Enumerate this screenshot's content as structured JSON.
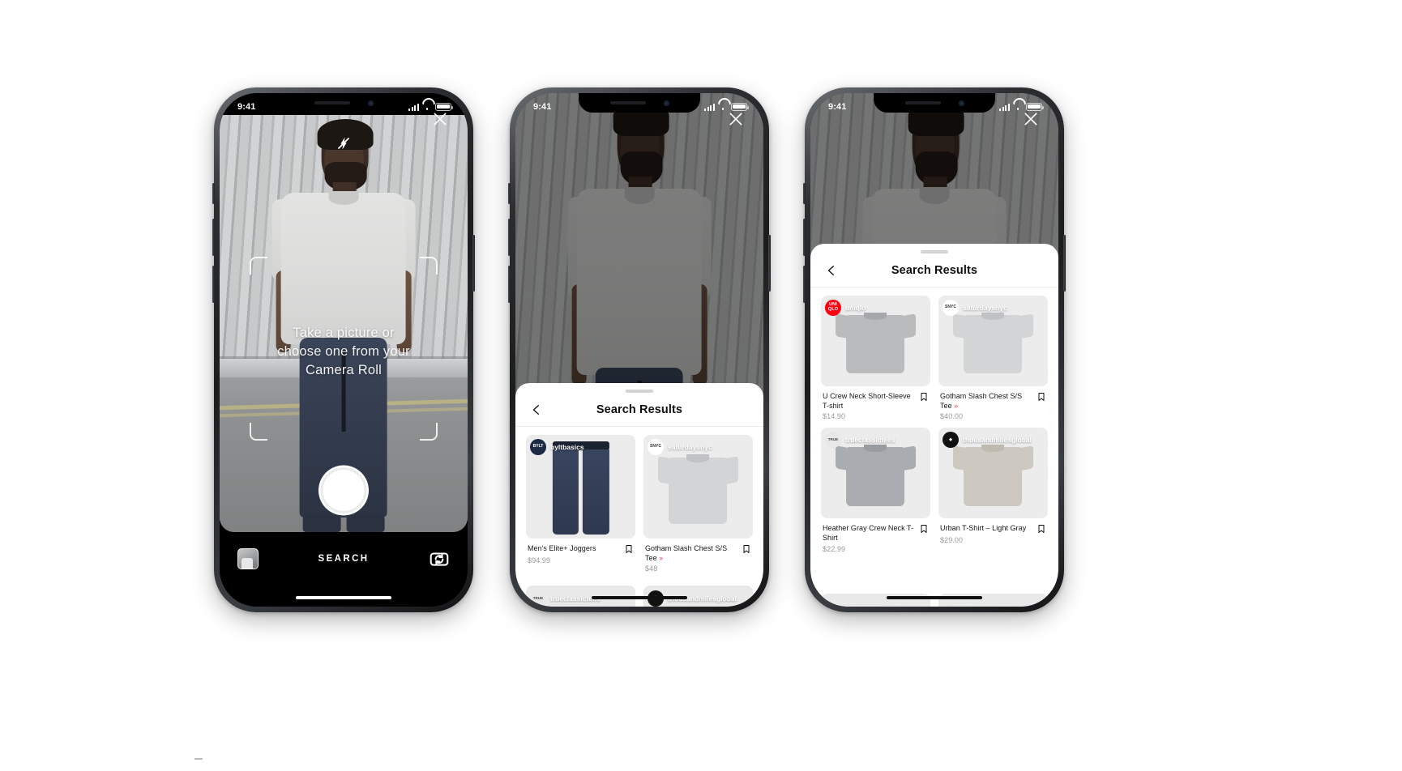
{
  "status_bar": {
    "time": "9:41"
  },
  "camera_screen": {
    "name": "visual-search-camera",
    "hint_lines": [
      "Take a picture or",
      "choose one from your",
      "Camera Roll"
    ],
    "search_label": "SEARCH",
    "icons": {
      "flash": "flash-icon",
      "close": "close-icon",
      "gallery": "gallery-thumbnail-icon",
      "flip": "camera-flip-icon",
      "shutter": "shutter-button"
    }
  },
  "results_sheet": {
    "title": "Search Results",
    "back_icon": "chevron-left-icon",
    "grabber": "sheet-drag-handle"
  },
  "phone2": {
    "products": [
      {
        "brand": "byltbasics",
        "brand_logo_text": "BYLT",
        "title": "Men's Elite+ Joggers",
        "chevron": "",
        "price": "$94.99",
        "type": "joggers",
        "color": "navy"
      },
      {
        "brand": "saturdaysnyc",
        "brand_logo_text": "SNYC",
        "title": "Gotham Slash Chest S/S Tee",
        "chevron": "»",
        "price": "$48",
        "type": "tee",
        "color": "c-lgray"
      },
      {
        "brand": "trueclassictees",
        "brand_logo_text": "TRUE",
        "title": "",
        "chevron": "",
        "price": "",
        "type": "tee",
        "color": "c-mgray"
      },
      {
        "brand": "thousandmilesglobal",
        "brand_logo_text": "◈",
        "title": "",
        "chevron": "",
        "price": "",
        "type": "tee",
        "color": "c-beige"
      }
    ]
  },
  "phone3": {
    "products": [
      {
        "brand": "uniqlo",
        "brand_logo_text": "UNI QLO",
        "title": "U Crew Neck Short-Sleeve T-shirt",
        "chevron": "",
        "price": "$14.90",
        "type": "tee",
        "color": "c-gray"
      },
      {
        "brand": "saturdaysnyc",
        "brand_logo_text": "SNYC",
        "title": "Gotham Slash Chest S/S Tee",
        "chevron": "»",
        "price": "$40.00",
        "type": "tee",
        "color": "c-lgray"
      },
      {
        "brand": "trueclassictees",
        "brand_logo_text": "TRUE",
        "title": "Heather Gray Crew Neck T-Shirt",
        "chevron": "",
        "price": "$22.99",
        "type": "tee",
        "color": "c-mgray"
      },
      {
        "brand": "thousandmilesglobal",
        "brand_logo_text": "◈",
        "title": "Urban T-Shirt – Light Gray",
        "chevron": "",
        "price": "$29.00",
        "type": "tee",
        "color": "c-beige"
      }
    ]
  },
  "colors": {
    "accent_red": "#e8455b",
    "uniqlo_red": "#ff0011",
    "sheet_bg": "#ffffff",
    "card_bg": "#ececec",
    "price_gray": "#9a9a9a"
  }
}
